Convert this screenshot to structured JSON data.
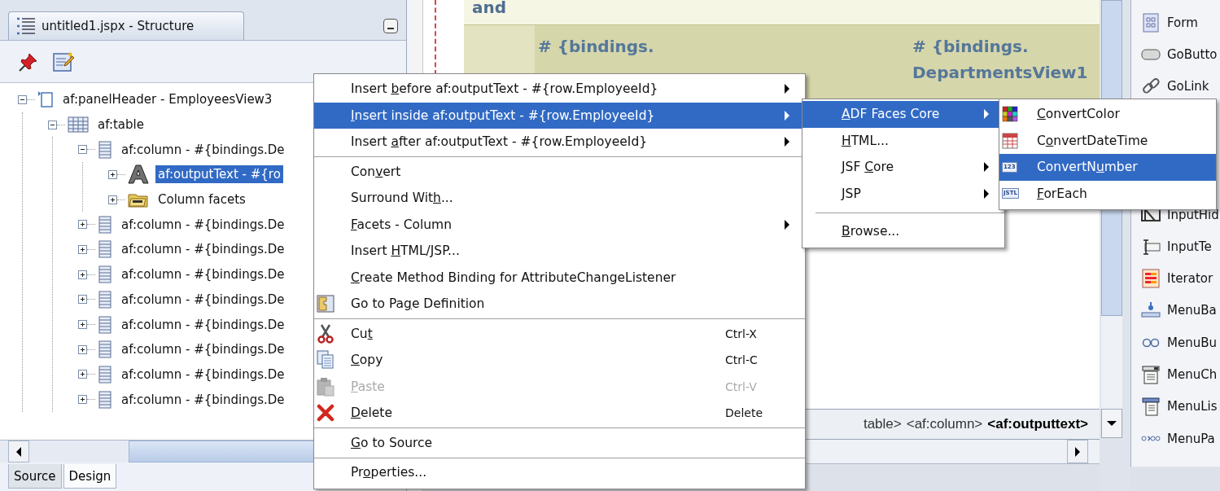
{
  "structure_panel": {
    "title": "untitled1.jspx - Structure",
    "tree": [
      {
        "kind": "header",
        "label": "af:panelHeader - EmployeesView3",
        "expanded": true,
        "selected": false,
        "children": [
          {
            "kind": "table",
            "label": "af:table",
            "expanded": true,
            "selected": false,
            "children": [
              {
                "kind": "column",
                "label": "af:column - #{bindings.De",
                "expanded": true,
                "selected": false,
                "children": [
                  {
                    "kind": "output",
                    "label": "af:outputText - #{ro",
                    "expanded": false,
                    "selected": true
                  },
                  {
                    "kind": "facets",
                    "label": "Column facets",
                    "expanded": false,
                    "selected": false
                  }
                ]
              },
              {
                "kind": "column",
                "label": "af:column - #{bindings.De",
                "expanded": false,
                "selected": false
              },
              {
                "kind": "column",
                "label": "af:column - #{bindings.De",
                "expanded": false,
                "selected": false
              },
              {
                "kind": "column",
                "label": "af:column - #{bindings.De",
                "expanded": false,
                "selected": false
              },
              {
                "kind": "column",
                "label": "af:column - #{bindings.De",
                "expanded": false,
                "selected": false
              },
              {
                "kind": "column",
                "label": "af:column - #{bindings.De",
                "expanded": false,
                "selected": false
              },
              {
                "kind": "column",
                "label": "af:column - #{bindings.De",
                "expanded": false,
                "selected": false
              },
              {
                "kind": "column",
                "label": "af:column - #{bindings.De",
                "expanded": false,
                "selected": false
              },
              {
                "kind": "column",
                "label": "af:column - #{bindings.De",
                "expanded": false,
                "selected": false
              }
            ]
          }
        ]
      }
    ],
    "tabs": [
      {
        "label": "Source",
        "selected": false
      },
      {
        "label": "Design",
        "selected": true
      }
    ]
  },
  "editor": {
    "heading": "and",
    "cells": [
      [
        "# {bindings."
      ],
      [
        "# {bindings.",
        "DepartmentsView1"
      ]
    ],
    "breadcrumb": [
      {
        "text": "table>",
        "current": false
      },
      {
        "text": "<af:column>",
        "current": false
      },
      {
        "text": "<af:outputtext>",
        "current": true
      }
    ]
  },
  "palette": {
    "items_top": [
      {
        "kind": "form",
        "label": "Form"
      },
      {
        "kind": "button",
        "label": "GoButto"
      },
      {
        "kind": "link",
        "label": "GoLink"
      }
    ],
    "items_bottom": [
      {
        "kind": "hidden",
        "label": "InputHid"
      },
      {
        "kind": "input",
        "label": "InputTe"
      },
      {
        "kind": "iterator",
        "label": "Iterator"
      },
      {
        "kind": "menubar",
        "label": "MenuBa"
      },
      {
        "kind": "menubuttons",
        "label": "MenuBu"
      },
      {
        "kind": "menuchoice",
        "label": "MenuCh"
      },
      {
        "kind": "menulist",
        "label": "MenuLis"
      },
      {
        "kind": "menupath",
        "label": "MenuPa"
      }
    ]
  },
  "context_menu": {
    "items": [
      {
        "kind": "plain",
        "label": {
          "pre": "Insert ",
          "key": "b",
          "post": "efore af:outputText - #{row.EmployeeId}"
        },
        "submenu": true,
        "selected": false,
        "disabled": false
      },
      {
        "kind": "plain",
        "label": {
          "key": "I",
          "post": "nsert inside af:outputText - #{row.EmployeeId}"
        },
        "submenu": true,
        "selected": true,
        "disabled": false
      },
      {
        "kind": "plain",
        "label": {
          "pre": "Insert ",
          "key": "a",
          "post": "fter af:outputText - #{row.EmployeeId}"
        },
        "submenu": true,
        "selected": false,
        "disabled": false
      },
      {
        "kind": "separator"
      },
      {
        "kind": "plain",
        "label": {
          "pre": "Con",
          "key": "v",
          "post": "ert"
        },
        "submenu": false,
        "selected": false,
        "disabled": false
      },
      {
        "kind": "plain",
        "label": {
          "pre": "Surround Wit",
          "key": "h",
          "post": "..."
        },
        "submenu": false,
        "selected": false,
        "disabled": false
      },
      {
        "kind": "plain",
        "label": {
          "key": "F",
          "post": "acets - Column"
        },
        "submenu": true,
        "selected": false,
        "disabled": false
      },
      {
        "kind": "plain",
        "label": {
          "pre": "Insert ",
          "key": "H",
          "post": "TML/JSP..."
        },
        "submenu": false,
        "selected": false,
        "disabled": false
      },
      {
        "kind": "plain",
        "label": {
          "key": "C",
          "post": "reate Method Binding for AttributeChangeListener"
        },
        "submenu": false,
        "selected": false,
        "disabled": false
      },
      {
        "kind": "page",
        "label": {
          "pre": "Go to Pa",
          "key": "g",
          "post": "e Definition"
        },
        "submenu": false,
        "selected": false,
        "disabled": false
      },
      {
        "kind": "separator"
      },
      {
        "kind": "cut",
        "label": {
          "pre": "Cu",
          "key": "t"
        },
        "shortcut": "Ctrl-X",
        "submenu": false,
        "selected": false,
        "disabled": false
      },
      {
        "kind": "copy",
        "label": {
          "key": "C",
          "post": "opy"
        },
        "shortcut": "Ctrl-C",
        "submenu": false,
        "selected": false,
        "disabled": false
      },
      {
        "kind": "paste",
        "label": {
          "key": "P",
          "post": "aste"
        },
        "shortcut": "Ctrl-V",
        "submenu": false,
        "selected": false,
        "disabled": true
      },
      {
        "kind": "delete",
        "label": {
          "key": "D",
          "post": "elete"
        },
        "shortcut": "Delete",
        "submenu": false,
        "selected": false,
        "disabled": false
      },
      {
        "kind": "separator"
      },
      {
        "kind": "plain",
        "label": {
          "key": "G",
          "post": "o to Source"
        },
        "submenu": false,
        "selected": false,
        "disabled": false
      },
      {
        "kind": "separator"
      },
      {
        "kind": "plain",
        "label": {
          "pre": "Pr",
          "key": "o",
          "post": "perties..."
        },
        "submenu": false,
        "selected": false,
        "disabled": false
      }
    ]
  },
  "submenu": {
    "items": [
      {
        "kind": "plain",
        "label": {
          "key": "A",
          "post": "DF Faces Core"
        },
        "submenu": true,
        "selected": true,
        "disabled": false
      },
      {
        "kind": "plain",
        "label": {
          "key": "H",
          "post": "TML..."
        },
        "submenu": false,
        "selected": false,
        "disabled": false
      },
      {
        "kind": "plain",
        "label": {
          "pre": "JSF ",
          "key": "C",
          "post": "ore"
        },
        "submenu": true,
        "selected": false,
        "disabled": false
      },
      {
        "kind": "plain",
        "label": {
          "key": "J",
          "post": "SP"
        },
        "submenu": true,
        "selected": false,
        "disabled": false
      },
      {
        "kind": "separator"
      },
      {
        "kind": "plain",
        "label": {
          "key": "B",
          "post": "rowse..."
        },
        "submenu": false,
        "selected": false,
        "disabled": false
      }
    ]
  },
  "submenu_2": {
    "items": [
      {
        "kind": "color",
        "label": {
          "key": "C",
          "post": "onvertColor"
        },
        "submenu": false,
        "selected": false,
        "disabled": false
      },
      {
        "kind": "datetime",
        "label": {
          "pre": "C",
          "key": "o",
          "post": "nvertDateTime"
        },
        "submenu": false,
        "selected": false,
        "disabled": false
      },
      {
        "kind": "badge",
        "icon_text": "123",
        "label": {
          "pre": "ConvertN",
          "key": "u",
          "post": "mber"
        },
        "submenu": false,
        "selected": true,
        "disabled": false
      },
      {
        "kind": "badge",
        "icon_text": "JSTL",
        "label": {
          "key": "F",
          "post": "orEach"
        },
        "submenu": false,
        "selected": false,
        "disabled": false
      }
    ]
  }
}
